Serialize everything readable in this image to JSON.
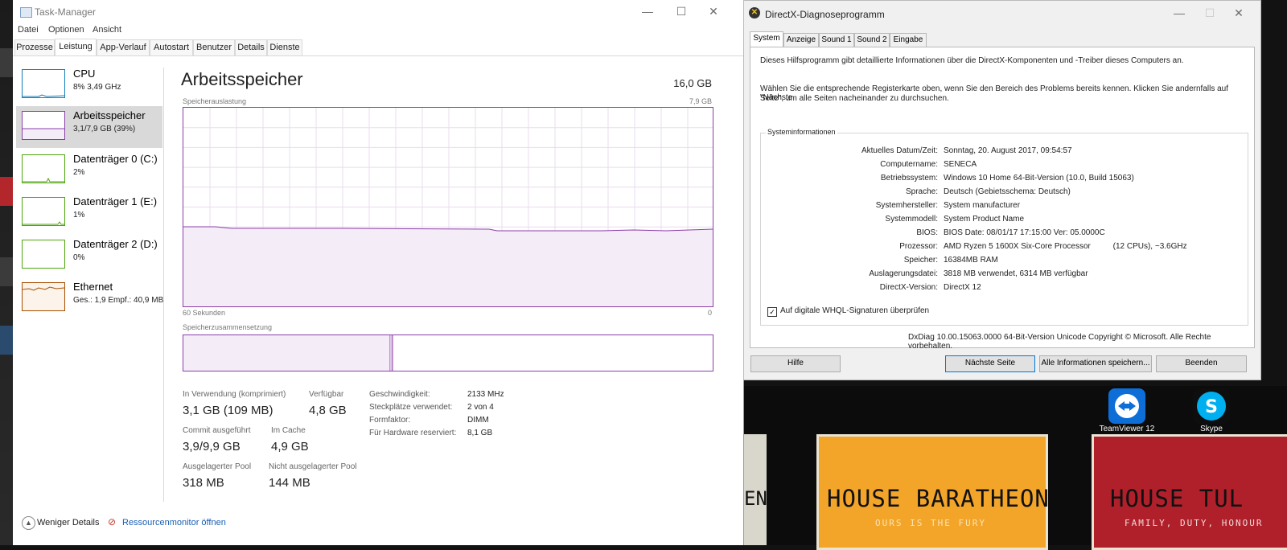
{
  "taskmanager": {
    "title": "Task-Manager",
    "window_buttons": [
      "—",
      "☐",
      "✕"
    ],
    "menu": [
      "Datei",
      "Optionen",
      "Ansicht"
    ],
    "tabs": [
      "Prozesse",
      "Leistung",
      "App-Verlauf",
      "Autostart",
      "Benutzer",
      "Details",
      "Dienste"
    ],
    "active_tab": "Leistung",
    "sidebar": [
      {
        "name": "CPU",
        "sub": "8% 3,49 GHz",
        "color": "#117dbb"
      },
      {
        "name": "Arbeitsspeicher",
        "sub": "3,1/7,9 GB (39%)",
        "color": "#8b3fa8"
      },
      {
        "name": "Datenträger 0 (C:)",
        "sub": "2%",
        "color": "#4da60c"
      },
      {
        "name": "Datenträger 1 (E:)",
        "sub": "1%",
        "color": "#4da60c"
      },
      {
        "name": "Datenträger 2 (D:)",
        "sub": "0%",
        "color": "#4da60c"
      },
      {
        "name": "Ethernet",
        "sub": "Ges.: 1,9 Empf.: 40,9 MB",
        "color": "#a74f01"
      }
    ],
    "main": {
      "title": "Arbeitsspeicher",
      "total": "16,0 GB",
      "graph_label": "Speicherauslastung",
      "graph_max": "7,9 GB",
      "graph_left": "60 Sekunden",
      "graph_right": "0",
      "composition_label": "Speicherzusammensetzung",
      "usage_fraction": 0.39,
      "stats": {
        "in_use_label": "In Verwendung (komprimiert)",
        "in_use_value": "3,1 GB (109 MB)",
        "available_label": "Verfügbar",
        "available_value": "4,8 GB",
        "commit_label": "Commit ausgeführt",
        "commit_value": "3,9/9,9 GB",
        "cache_label": "Im Cache",
        "cache_value": "4,9 GB",
        "paged_label": "Ausgelagerter Pool",
        "paged_value": "318 MB",
        "nonpaged_label": "Nicht ausgelagerter Pool",
        "nonpaged_value": "144 MB"
      },
      "specs": [
        {
          "label": "Geschwindigkeit:",
          "value": "2133 MHz"
        },
        {
          "label": "Steckplätze verwendet:",
          "value": "2 von 4"
        },
        {
          "label": "Formfaktor:",
          "value": "DIMM"
        },
        {
          "label": "Für Hardware reserviert:",
          "value": "8,1 GB"
        }
      ]
    },
    "footer": {
      "less_details": "Weniger Details",
      "resource_monitor": "Ressourcenmonitor öffnen"
    }
  },
  "dxdiag": {
    "title": "DirectX-Diagnoseprogramm",
    "tabs": [
      "System",
      "Anzeige",
      "Sound 1",
      "Sound 2",
      "Eingabe"
    ],
    "intro1": "Dieses Hilfsprogramm gibt detaillierte Informationen über die DirectX-Komponenten und -Treiber dieses Computers an.",
    "intro2a": "Wählen Sie die entsprechende Registerkarte oben, wenn Sie den Bereich des Problems bereits kennen. Klicken Sie andernfalls auf \"Nächste",
    "intro2b": "Seite\", um alle Seiten nacheinander zu durchsuchen.",
    "group_title": "Systeminformationen",
    "rows": [
      {
        "label": "Aktuelles Datum/Zeit:",
        "value": "Sonntag, 20. August 2017, 09:54:57"
      },
      {
        "label": "Computername:",
        "value": "SENECA"
      },
      {
        "label": "Betriebssystem:",
        "value": "Windows 10 Home 64-Bit-Version (10.0, Build 15063)"
      },
      {
        "label": "Sprache:",
        "value": "Deutsch (Gebietsschema: Deutsch)"
      },
      {
        "label": "Systemhersteller:",
        "value": "System manufacturer"
      },
      {
        "label": "Systemmodell:",
        "value": "System Product Name"
      },
      {
        "label": "BIOS:",
        "value": "BIOS Date: 08/01/17 17:15:00 Ver: 05.0000C"
      },
      {
        "label": "Prozessor:",
        "value": "AMD Ryzen 5 1600X Six-Core Processor          (12 CPUs), ~3.6GHz"
      },
      {
        "label": "Speicher:",
        "value": "16384MB RAM"
      },
      {
        "label": "Auslagerungsdatei:",
        "value": "3818 MB verwendet, 6314 MB verfügbar"
      },
      {
        "label": "DirectX-Version:",
        "value": "DirectX 12"
      }
    ],
    "checkbox_label": "Auf digitale WHQL-Signaturen überprüfen",
    "copyright": "DxDiag 10.00.15063.0000 64-Bit-Version Unicode Copyright © Microsoft. Alle Rechte vorbehalten.",
    "buttons": [
      "Hilfe",
      "Nächste Seite",
      "Alle Informationen speichern...",
      "Beenden"
    ]
  },
  "desktop": {
    "icons": [
      {
        "label": "TeamViewer 12",
        "color": "#0e6ed8"
      },
      {
        "label": "Skype",
        "color": "#00aff0"
      }
    ],
    "poster1_title": "HOUSE BARATHEON",
    "poster1_motto": "OURS IS THE FURY",
    "poster2_title": "HOUSE TUL",
    "poster2_motto": "FAMILY, DUTY, HONOUR",
    "poster0_fragment": "EN"
  }
}
